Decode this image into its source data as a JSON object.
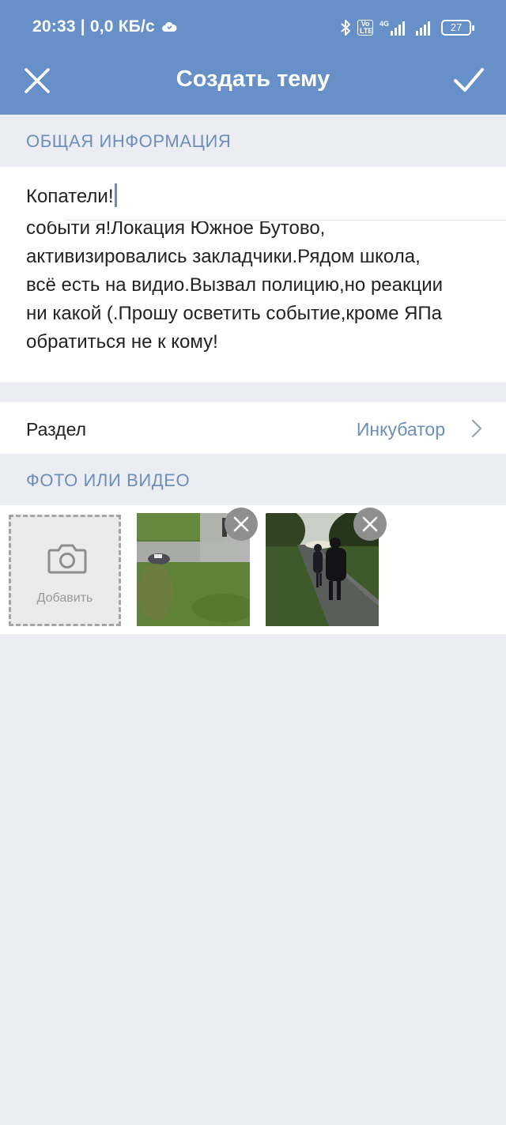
{
  "status_bar": {
    "time": "20:33",
    "network_speed": "| 0,0 КБ/с",
    "network_type": "4G",
    "volte": "Vo LTE",
    "battery": "27"
  },
  "header": {
    "title": "Создать тему",
    "close_icon": "close-icon",
    "done_icon": "checkmark-icon"
  },
  "general": {
    "section_label": "ОБЩАЯ ИНФОРМАЦИЯ",
    "title_value": "Копатели!",
    "description_lines": [
      "событи я!Локация Южное Бутово,",
      "активизировались закладчики.Рядом школа,",
      "всё есть на видио.Вызвал полицию,но реакции",
      "ни какой (.Прошу осветить событие,кроме ЯПа",
      "обратиться не к кому!"
    ]
  },
  "section_row": {
    "label": "Раздел",
    "value": "Инкубатор"
  },
  "media": {
    "section_label": "ФОТО ИЛИ ВИДЕО",
    "add_label": "Добавить",
    "thumbnails": [
      "photo-1",
      "photo-2"
    ]
  },
  "colors": {
    "header_bg": "#6890c8",
    "accent": "#6c8eb9",
    "page_bg": "#ebedf3"
  }
}
